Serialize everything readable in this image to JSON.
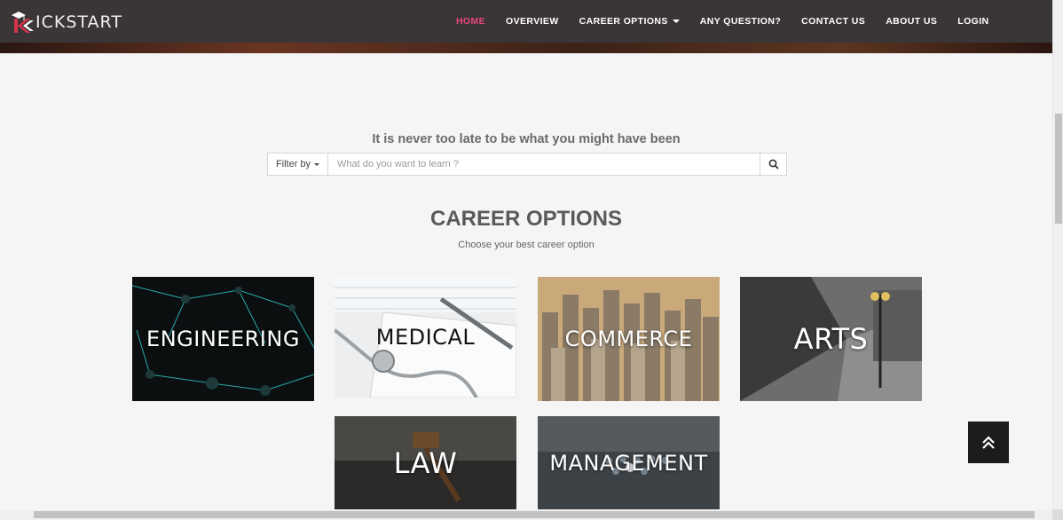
{
  "brand": {
    "name": "KICKSTART",
    "first_letter": "K",
    "rest": "ICKSTART"
  },
  "nav": {
    "items": [
      {
        "label": "HOME",
        "active": true
      },
      {
        "label": "OVERVIEW"
      },
      {
        "label": "CAREER OPTIONS",
        "dropdown": true
      },
      {
        "label": "ANY QUESTION?"
      },
      {
        "label": "CONTACT US"
      },
      {
        "label": "ABOUT US"
      },
      {
        "label": "LOGIN"
      }
    ]
  },
  "hero": {
    "tagline": "It is never too late to be what you might have been"
  },
  "search": {
    "filter_label": "Filter by",
    "placeholder": "What do you want to learn ?",
    "value": "",
    "icon": "search-icon"
  },
  "career": {
    "title": "CAREER OPTIONS",
    "subtitle": "Choose your best career option",
    "cards": [
      {
        "label": "ENGINEERING"
      },
      {
        "label": "MEDICAL"
      },
      {
        "label": "COMMERCE"
      },
      {
        "label": "ARTS"
      },
      {
        "label": "LAW"
      },
      {
        "label": "MANAGEMENT"
      }
    ]
  },
  "back_to_top": {
    "icon": "double-chevron-up-icon"
  },
  "colors": {
    "nav_bg": "#3a3536",
    "accent": "#e8457c",
    "brand_red": "#d8334a",
    "page_bg": "#f5f5f5"
  }
}
